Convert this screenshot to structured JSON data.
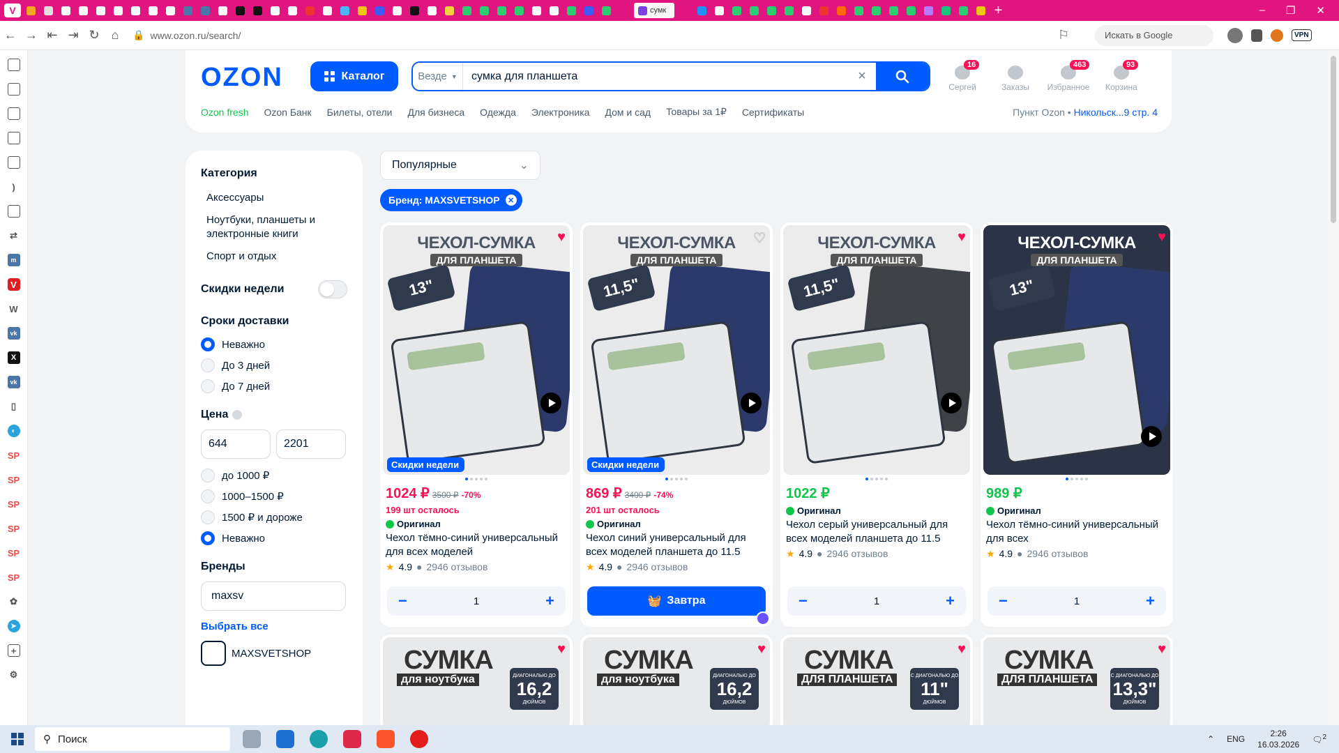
{
  "browser": {
    "active_tab_label": "сумк",
    "url": "www.ozon.ru/search/",
    "google_search": "Искать в Google",
    "vpn": "VPN"
  },
  "sidebar_icons": [
    "notes-icon",
    "translate-icon",
    "mail-icon",
    "calendar-icon",
    "tasks-icon",
    "feed-icon",
    "contacts-icon",
    "sync-icon",
    "mastodon-icon",
    "vivaldi-icon",
    "wikipedia-icon",
    "vk-icon",
    "x-icon",
    "vk-icon",
    "document-icon",
    "wikiloc-icon",
    "sp-icon",
    "sp-icon",
    "sp-icon",
    "sp-icon",
    "sp-icon",
    "sp-icon",
    "apps-icon",
    "telegram-icon",
    "add-panel-icon",
    "settings-icon"
  ],
  "header": {
    "logo": "OZON",
    "catalog": "Каталог",
    "search_scope": "Везде",
    "search_query": "сумка для планшета",
    "icons": [
      {
        "label": "Сергей",
        "badge": "16"
      },
      {
        "label": "Заказы",
        "badge": ""
      },
      {
        "label": "Избранное",
        "badge": "463"
      },
      {
        "label": "Корзина",
        "badge": "93"
      }
    ],
    "subnav": [
      "Ozon fresh",
      "Ozon Банк",
      "Билеты, отели",
      "Для бизнеса",
      "Одежда",
      "Электроника",
      "Дом и сад",
      "Товары за 1₽",
      "Сертификаты"
    ],
    "pickup_label": "Пункт Ozon •",
    "pickup_value": "Никольск...9 стр. 4"
  },
  "filters": {
    "category_title": "Категория",
    "categories": [
      "Аксессуары",
      "Ноутбуки, планшеты и электронные книги",
      "Спорт и отдых"
    ],
    "weekly_discounts": "Скидки недели",
    "delivery_title": "Сроки доставки",
    "delivery": [
      "Неважно",
      "До 3 дней",
      "До 7 дней"
    ],
    "price_title": "Цена",
    "price_from": "644",
    "price_to": "2201",
    "price_options": [
      "до 1000 ₽",
      "1000–1500 ₽",
      "1500 ₽ и дороже",
      "Неважно"
    ],
    "brands_title": "Бренды",
    "brand_search": "maxsv",
    "select_all": "Выбрать все",
    "brand_item": "MAXSVETSHOP"
  },
  "sort": "Популярные",
  "chip": "Бренд: MAXSVETSHOP",
  "products": [
    {
      "img_title": "ЧЕХОЛ-СУМКА",
      "img_sub": "ДЛЯ ПЛАНШЕТА",
      "size": "13\"",
      "promo": "Скидки недели",
      "price": "1024 ₽",
      "old": "3500 ₽",
      "disc": "-70%",
      "left": "199 шт осталось",
      "orig": "Оригинал",
      "title": "Чехол тёмно-синий универсальный для всех моделей",
      "rating": "4.9",
      "reviews": "2946 отзывов",
      "qty": "1",
      "video": "Видео"
    },
    {
      "img_title": "ЧЕХОЛ-СУМКА",
      "img_sub": "ДЛЯ ПЛАНШЕТА",
      "size": "11,5\"",
      "promo": "Скидки недели",
      "price": "869 ₽",
      "old": "3400 ₽",
      "disc": "-74%",
      "left": "201 шт осталось",
      "orig": "Оригинал",
      "title": "Чехол синий универсальный для всех моделей планшета до 11.5",
      "rating": "4.9",
      "reviews": "2946 отзывов",
      "buy": "Завтра",
      "video": "Видео"
    },
    {
      "img_title": "ЧЕХОЛ-СУМКА",
      "img_sub": "ДЛЯ ПЛАНШЕТА",
      "size": "11,5\"",
      "price": "1022 ₽",
      "orig": "Оригинал",
      "title": "Чехол серый универсальный для всех моделей планшета до 11.5",
      "rating": "4.9",
      "reviews": "2946 отзывов",
      "qty": "1",
      "video": "Видео"
    },
    {
      "img_title": "ЧЕХОЛ-СУМКА",
      "img_sub": "ДЛЯ ПЛАНШЕТА",
      "size": "13\"",
      "price": "989 ₽",
      "orig": "Оригинал",
      "title": "Чехол тёмно-синий универсальный для всех",
      "rating": "4.9",
      "reviews": "2946 отзывов",
      "qty": "1",
      "video": "Видео"
    }
  ],
  "products_row2": [
    {
      "big": "СУМКА",
      "small": "для ноутбука",
      "size": "16,2",
      "unit": "ДЮЙМОВ",
      "pre": "ДИАГОНАЛЬЮ ДО"
    },
    {
      "big": "СУМКА",
      "small": "для ноутбука",
      "size": "16,2",
      "unit": "ДЮЙМОВ",
      "pre": "ДИАГОНАЛЬЮ ДО"
    },
    {
      "big": "СУМКА",
      "small": "ДЛЯ ПЛАНШЕТА",
      "size": "11\"",
      "unit": "ДЮЙМОВ",
      "pre": "С ДИАГОНАЛЬЮ ДО"
    },
    {
      "big": "СУМКА",
      "small": "ДЛЯ ПЛАНШЕТА",
      "size": "13,3\"",
      "unit": "ДЮЙМОВ",
      "pre": "С ДИАГОНАЛЬЮ ДО"
    }
  ],
  "taskbar": {
    "search": "Поиск",
    "lang": "ENG",
    "time": "2:26",
    "date": "16.03.2026",
    "notif": "2"
  },
  "colors": {
    "accent": "#005bff",
    "price": "#f91155",
    "green": "#10c44c",
    "tabbar": "#e0157f"
  }
}
